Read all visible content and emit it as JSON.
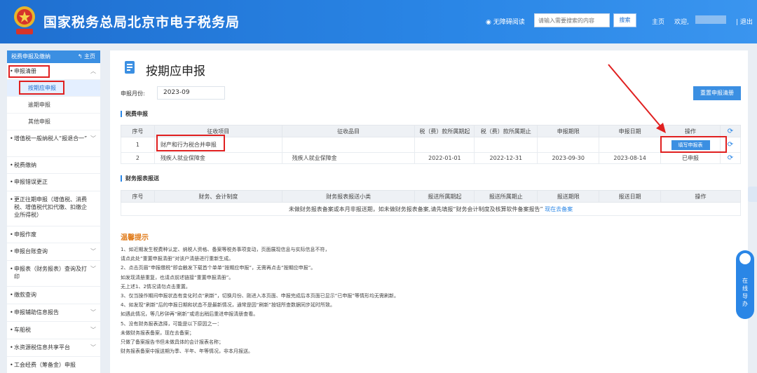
{
  "header": {
    "title": "国家税务总局北京市电子税务局",
    "accessibility": "无障碍阅读",
    "search_placeholder": "请输入需要搜索的内容",
    "search_button": "搜索",
    "nav_home": "主页",
    "nav_welcome": "欢迎,",
    "nav_logout": "退出"
  },
  "sidebar": {
    "head": "税费申报及缴纳",
    "home": "主页",
    "group1": "申报清册",
    "sub_items": [
      "按期应申报",
      "逾期申报",
      "其他申报"
    ],
    "items": [
      "增值税一般纳税人“报退合一”",
      "税费缴纳",
      "申报错误更正",
      "更正往期申报（增值税、消费税、增值税代扣代缴、扣缴企业所得税）",
      "申报作废",
      "申报台账查询",
      "申报表（财务报表）查询及打印",
      "缴款查询",
      "申报辅助信息报告",
      "车船税",
      "水资源税信息共享平台",
      "工会经费（筹备金）申报"
    ]
  },
  "main": {
    "title": "按期应申报",
    "month_label": "申报月份:",
    "month_value": "2023-09",
    "reset_button": "重置申报清册",
    "section1": "税费申报",
    "table1": {
      "headers": [
        "序号",
        "征收项目",
        "征收品目",
        "税（费）款所属期起",
        "税（费）款所属期止",
        "申报期限",
        "申报日期",
        "操作"
      ],
      "rows": [
        [
          "1",
          "财产和行为税合并申报",
          "",
          "",
          "",
          "",
          "",
          "填写申报表"
        ],
        [
          "2",
          "残疾人就业保障金",
          "残疾人就业保障金",
          "2022-01-01",
          "2022-12-31",
          "2023-09-30",
          "2023-08-14",
          "已申报"
        ]
      ]
    },
    "section2": "财务报表报送",
    "table2": {
      "headers": [
        "序号",
        "财务、会计制度",
        "财务报表报送小类",
        "报送所属期起",
        "报送所属期止",
        "报送期限",
        "报送日期",
        "操作"
      ],
      "empty_text": "未做财务报表备案或本月非报送期，如未做财务报表备案,请先填报“财务会计制度及核算软件备案报告”",
      "empty_link": "现在去备案"
    },
    "tips_title": "温馨提示",
    "tips": [
      "1、如近期发生税费种认定、纳税人资格、备案等税务事项变动，页面展现信息与实际信息不符，",
      "请点此处“重置申报清册”对该户清册进行重新生成。",
      "2、点击页眉“申报缴税”即会触发下载首个单单“按期应申报”，无需再点击“按期应申报”。",
      "如发现清册重复，也请点前述链接“重置申报清册”。",
      "无上述1、2情况请勿点击重置。",
      "3、仅当操作期间申报状态有变化时点“刷新”，切换月份、刚进入本页面、申报完成后本页面已显示“已申报”等情形均无需刷新。",
      "4、如发现“刷新”后的申报日期和状态不是最新情况，通常是因“刷新”按钮所查数据同步延时所致。",
      "如遇此情况，等几秒钟再“刷新”或退出稍后重进申报清册查看。",
      "5、没有财务报表选择，可能是以下原因之一：",
      "未做财务报表备案，现在去备案；",
      "只做了备案报告书但未做具体的会计报表名称；",
      "财务报表备案中报送期为季、半年、年等情况，非本月报送。"
    ]
  },
  "float": {
    "online_help": "在线导办"
  },
  "colors": {
    "header_blue": "#2a86e6",
    "button_blue": "#3b8fe2",
    "annotation_red": "#e02020",
    "tips_orange": "#e07b1a"
  }
}
